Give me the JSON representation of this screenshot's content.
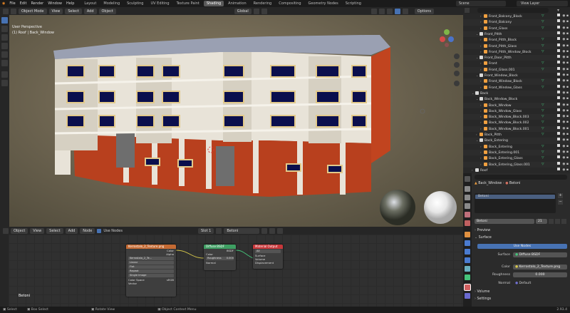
{
  "menubar": {
    "items": [
      "File",
      "Edit",
      "Render",
      "Window",
      "Help"
    ],
    "workspaces": [
      "Layout",
      "Modeling",
      "Sculpting",
      "UV Editing",
      "Texture Paint",
      "Shading",
      "Animation",
      "Rendering",
      "Compositing",
      "Geometry Nodes",
      "Scripting"
    ],
    "active_workspace": "Shading",
    "scene": "Scene",
    "view_layer": "View Layer"
  },
  "viewport": {
    "mode": "Object Mode",
    "menus": [
      "View",
      "Select",
      "Add",
      "Object"
    ],
    "orientation": "Global",
    "options": "Options",
    "view_name": "User Perspective",
    "context": "(1) Roof | Back_Window"
  },
  "node_editor": {
    "editor_type": "Object",
    "menus": [
      "View",
      "Select",
      "Add",
      "Node"
    ],
    "use_nodes_label": "Use Nodes",
    "slot": "Slot 1",
    "material": "Betoni",
    "label": "Betoni",
    "texture_node": {
      "title": "Kerrostalo_2_Texture.png",
      "outputs": [
        "Color",
        "Alpha"
      ],
      "image": "Kerrostalo_2_Te...",
      "interp": "Linear",
      "proj": "Flat",
      "ext": "Repeat",
      "source": "Single Image",
      "colorspace_label": "Color Space",
      "colorspace": "sRGB",
      "vector": "Vector"
    },
    "bsdf_node": {
      "title": "Diffuse BSDF",
      "output": "BSDF",
      "color": "Color",
      "roughness_label": "Roughness",
      "roughness": "0.000",
      "normal": "Normal"
    },
    "output_node": {
      "title": "Material Output",
      "target": "All",
      "inputs": [
        "Surface",
        "Volume",
        "Displacement"
      ]
    }
  },
  "outliner": {
    "rows": [
      {
        "label": "Front_Balcony_Block",
        "indent": 4,
        "icon": "mesh",
        "expanded": false
      },
      {
        "label": "Front_Balcony",
        "indent": 4,
        "icon": "mesh",
        "expanded": false
      },
      {
        "label": "Front_Glass",
        "indent": 4,
        "icon": "mesh",
        "expanded": false
      },
      {
        "label": "Front_Pitth",
        "indent": 3,
        "icon": "collection",
        "expanded": true
      },
      {
        "label": "Front_Pitth_Block",
        "indent": 4,
        "icon": "mesh",
        "expanded": false
      },
      {
        "label": "Front_Pitth_Glass",
        "indent": 4,
        "icon": "mesh",
        "expanded": false
      },
      {
        "label": "Front_Pitth_Window_Block",
        "indent": 4,
        "icon": "mesh",
        "expanded": false
      },
      {
        "label": "Front_Door_Pitth",
        "indent": 3,
        "icon": "collection",
        "expanded": true
      },
      {
        "label": "Front",
        "indent": 4,
        "icon": "mesh",
        "expanded": false
      },
      {
        "label": "Front_Glass.001",
        "indent": 4,
        "icon": "mesh",
        "expanded": false
      },
      {
        "label": "Front_Window_Block",
        "indent": 3,
        "icon": "collection",
        "expanded": true
      },
      {
        "label": "Front_Window_Block",
        "indent": 4,
        "icon": "mesh",
        "expanded": false
      },
      {
        "label": "Front_Window_Glass",
        "indent": 4,
        "icon": "mesh",
        "expanded": false
      },
      {
        "label": "Back",
        "indent": 2,
        "icon": "collection",
        "expanded": true
      },
      {
        "label": "Back_Window_Block",
        "indent": 3,
        "icon": "collection",
        "expanded": true
      },
      {
        "label": "Back_Window",
        "indent": 4,
        "icon": "mesh",
        "expanded": false
      },
      {
        "label": "Back_Window_Glass",
        "indent": 4,
        "icon": "mesh",
        "expanded": false
      },
      {
        "label": "Back_Window_Block.003",
        "indent": 4,
        "icon": "mesh",
        "expanded": false
      },
      {
        "label": "Back_Window_Block.002",
        "indent": 4,
        "icon": "mesh",
        "expanded": false
      },
      {
        "label": "Back_Window_Block.001",
        "indent": 4,
        "icon": "mesh",
        "expanded": false
      },
      {
        "label": "Back_Pitth",
        "indent": 3,
        "icon": "mesh",
        "expanded": false
      },
      {
        "label": "Back_Entering",
        "indent": 3,
        "icon": "collection",
        "expanded": true
      },
      {
        "label": "Back_Entering",
        "indent": 4,
        "icon": "mesh",
        "expanded": false
      },
      {
        "label": "Back_Entering.001",
        "indent": 4,
        "icon": "mesh",
        "expanded": false
      },
      {
        "label": "Back_Entering_Glass",
        "indent": 4,
        "icon": "mesh",
        "expanded": false
      },
      {
        "label": "Back_Entering_Glass.001",
        "indent": 4,
        "icon": "mesh",
        "expanded": false
      },
      {
        "label": "Roof",
        "indent": 2,
        "icon": "collection",
        "expanded": false
      }
    ]
  },
  "properties": {
    "object": "Back_Window",
    "material": "Betoni",
    "slot_name": "Betoni",
    "users": "21",
    "preview": "Preview",
    "surface": "Surface",
    "use_nodes": "Use Nodes",
    "surface_label": "Surface",
    "surface_value": "Diffuse BSDF",
    "color_label": "Color",
    "color_value": "Kerrostalo_2_Texture.png",
    "roughness_label": "Roughness",
    "roughness_value": "0.000",
    "normal_label": "Normal",
    "normal_value": "Default",
    "volume": "Volume",
    "settings": "Settings"
  },
  "statusbar": {
    "select": "Select",
    "box_select": "Box Select",
    "rotate": "Rotate View",
    "context_menu": "Object Context Menu",
    "version": "2.93.4"
  },
  "colors": {
    "accent": "#4772b3",
    "wall": "#e6e1d6",
    "brick": "#b8401e",
    "window": "#0b0f4d",
    "frame": "#e2c98a",
    "tex_header": "#c46a33",
    "bsdf_header": "#3e9e62",
    "output_header": "#c8383b"
  }
}
